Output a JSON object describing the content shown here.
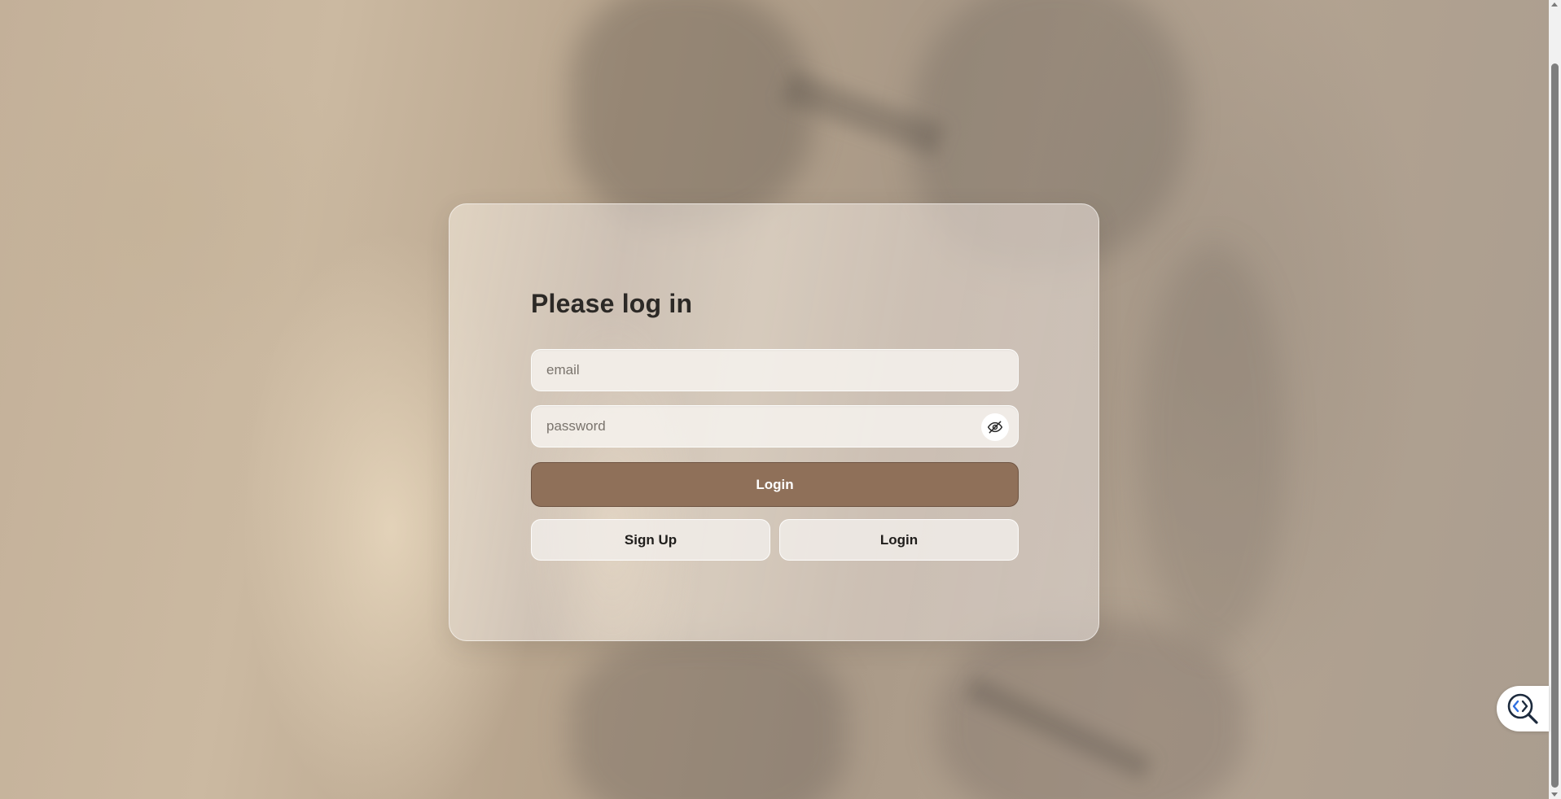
{
  "login": {
    "title": "Please log in",
    "email_placeholder": "email",
    "password_placeholder": "password",
    "password_toggle_icon": "eye-off-icon",
    "primary_button_label": "Login",
    "signup_button_label": "Sign Up",
    "secondary_login_button_label": "Login"
  },
  "widget": {
    "icon": "code-search-icon"
  },
  "colors": {
    "primary_button": "#8f7059",
    "title_text": "#2c2926"
  }
}
